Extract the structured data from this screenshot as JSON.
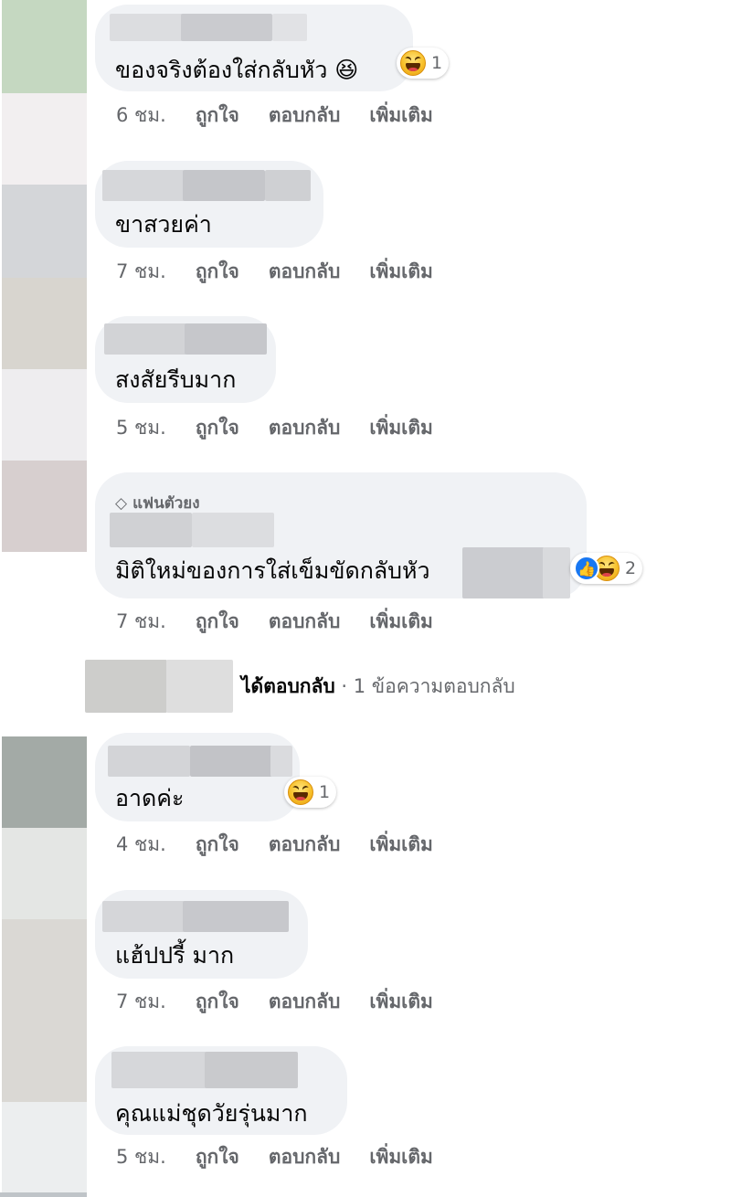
{
  "comments": [
    {
      "text": "ของจริงต้องใส่กลับหัว 😆",
      "time": "6 ชม.",
      "reaction_count": "1"
    },
    {
      "text": "ขาสวยค่า",
      "time": "7 ชม."
    },
    {
      "text": "สงสัยรีบมาก",
      "time": "5 ชม."
    },
    {
      "badge": "แฟนตัวยง",
      "text": "มิติใหม่ของการใส่เข็มขัดกลับหัว",
      "time": "7 ชม.",
      "reaction_count": "2"
    },
    {
      "text": "อาดค่ะ",
      "time": "4 ชม.",
      "reaction_count": "1"
    },
    {
      "text": "แฮ้ปปรี้ มาก",
      "time": "7 ชม."
    },
    {
      "text": "คุณแม่ชุดวัยรุ่นมาก",
      "time": "5 ชม."
    }
  ],
  "actions": {
    "like": "ถูกใจ",
    "reply": "ตอบกลับ",
    "more": "เพิ่มเติม"
  },
  "reply_summary": {
    "who": "ได้ตอบกลับ",
    "rest": " · 1 ข้อความตอบกลับ"
  },
  "icons": {
    "reaction_haha": "haha-emoji-icon",
    "reaction_like": "like-icon",
    "badge": "diamond-icon"
  },
  "colors": {
    "bubble": "#f0f2f5",
    "meta": "#65676b",
    "like_blue": "#1877f2",
    "text": "#050505"
  }
}
